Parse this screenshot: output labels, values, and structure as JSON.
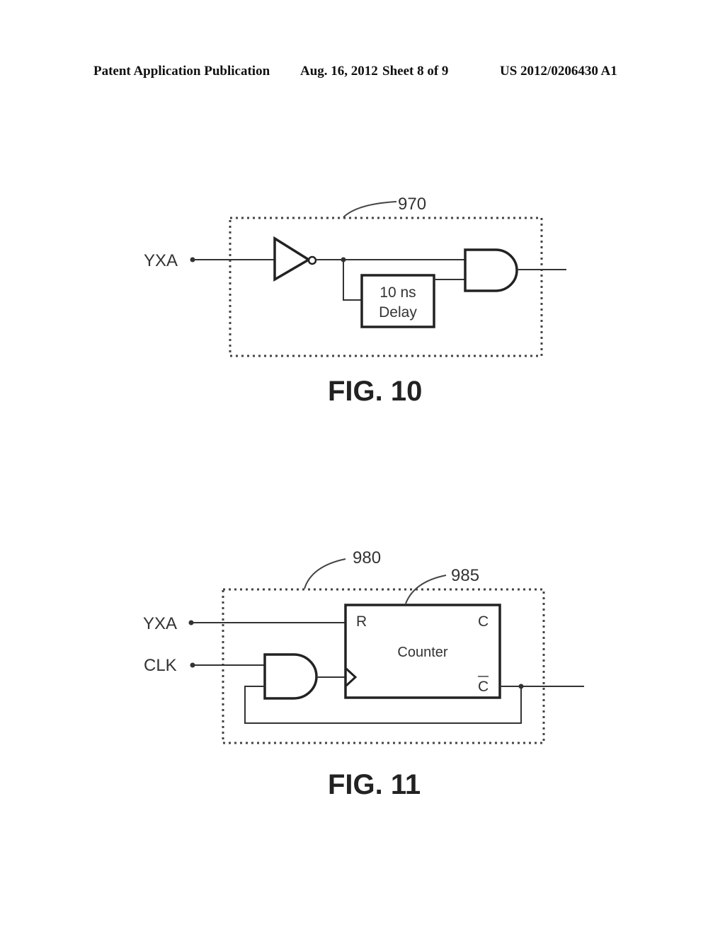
{
  "header": {
    "publication": "Patent Application Publication",
    "date": "Aug. 16, 2012",
    "sheet": "Sheet 8 of 9",
    "number": "US 2012/0206430 A1"
  },
  "fig10": {
    "caption": "FIG. 10",
    "ref_block": "970",
    "input_label": "YXA",
    "delay_line1": "10 ns",
    "delay_line2": "Delay"
  },
  "fig11": {
    "caption": "FIG. 11",
    "ref_block": "980",
    "ref_counter": "985",
    "input_yxa": "YXA",
    "input_clk": "CLK",
    "counter_label": "Counter",
    "pin_r": "R",
    "pin_c": "C",
    "pin_cbar": "C"
  }
}
